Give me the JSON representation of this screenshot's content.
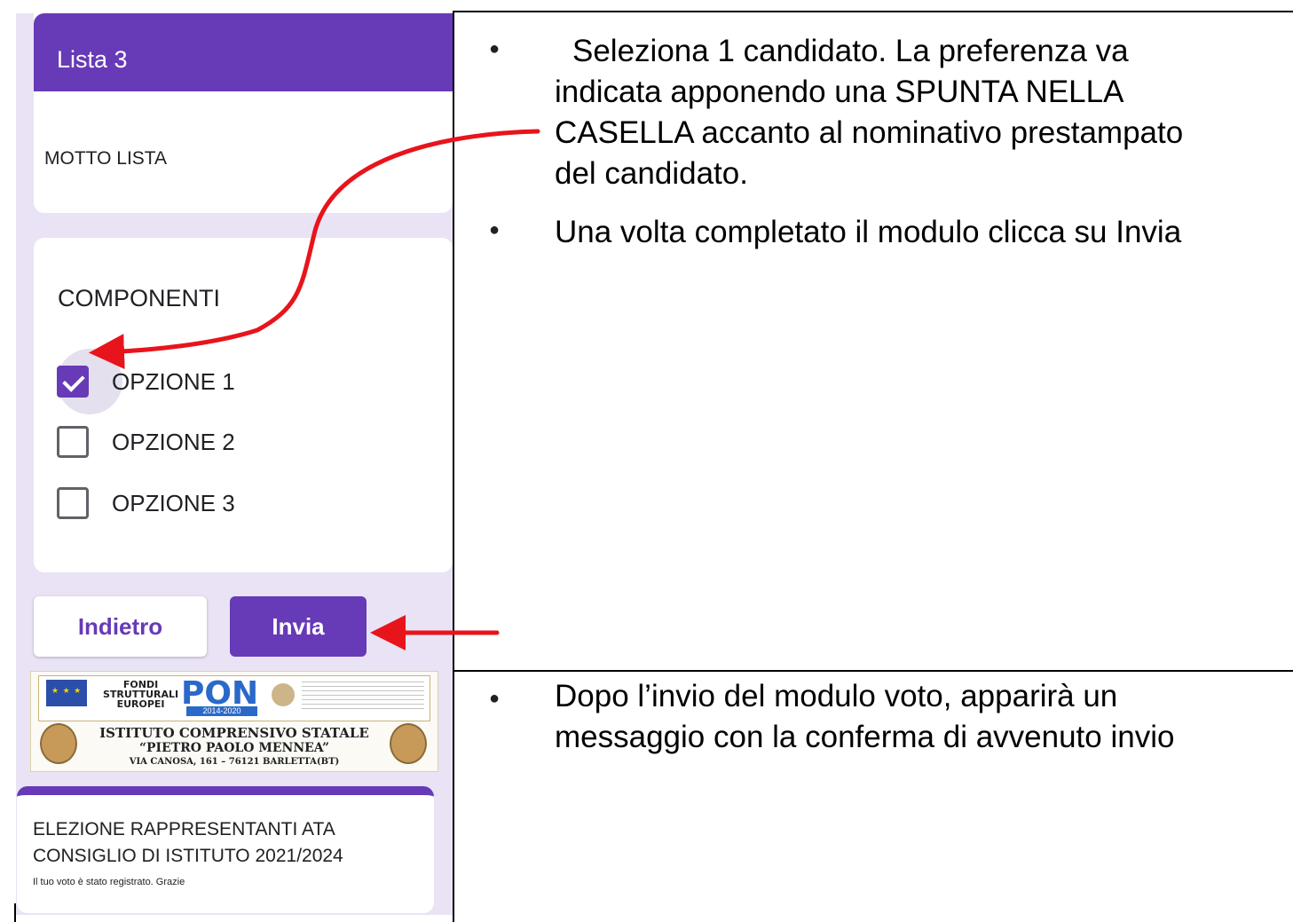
{
  "form": {
    "list_title": "Lista 3",
    "motto": "MOTTO LISTA",
    "question_title": "COMPONENTI",
    "options": [
      {
        "label": "OPZIONE 1",
        "checked": true
      },
      {
        "label": "OPZIONE 2",
        "checked": false
      },
      {
        "label": "OPZIONE 3",
        "checked": false
      }
    ],
    "back_label": "Indietro",
    "submit_label": "Invia",
    "accent_color": "#673ab7"
  },
  "banner": {
    "fondi_text": "FONDI\nSTRUTTURALI\nEUROPEI",
    "pon_text": "PON",
    "pon_years": "2014-2020",
    "school_name": "ISTITUTO COMPRENSIVO STATALE",
    "school_sub": "“PIETRO PAOLO MENNEA”",
    "school_addr": "VIA CANOSA, 161 – 76121 BARLETTA(BT)"
  },
  "confirmation": {
    "title_line1": "ELEZIONE RAPPRESENTANTI ATA",
    "title_line2": "CONSIGLIO DI ISTITUTO 2021/2024",
    "message": "Il tuo voto è stato registrato. Grazie"
  },
  "instructions": {
    "bullet_symbol": "●",
    "item1_lines": [
      "Seleziona 1 candidato. La preferenza va",
      "indicata apponendo una SPUNTA NELLA",
      "CASELLA accanto al nominativo prestampato",
      "del candidato."
    ],
    "item2": "Una volta completato il modulo clicca su Invia",
    "item3_lines": [
      "Dopo l’invio del modulo voto, apparirà un",
      "messaggio con la conferma di avvenuto invio"
    ]
  },
  "arrow_color": "#e8141c"
}
